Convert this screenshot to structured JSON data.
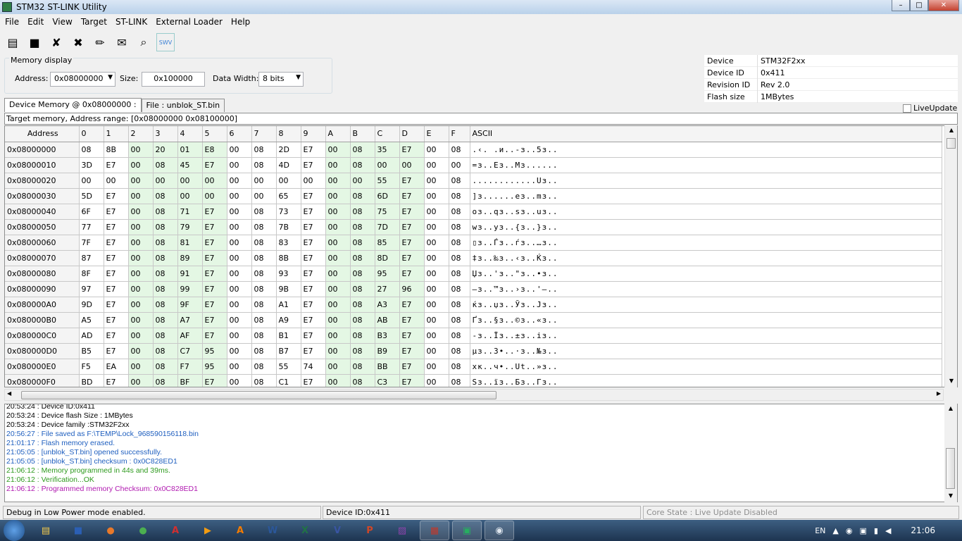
{
  "window": {
    "title": "STM32 ST-LINK Utility",
    "minimize": "–",
    "maximize": "□",
    "close": "✕"
  },
  "menu": [
    "File",
    "Edit",
    "View",
    "Target",
    "ST-LINK",
    "External Loader",
    "Help"
  ],
  "toolbar": [
    {
      "name": "open-file-icon",
      "glyph": "▤"
    },
    {
      "name": "save-file-icon",
      "glyph": "■"
    },
    {
      "name": "connect-icon",
      "glyph": "✘"
    },
    {
      "name": "disconnect-icon",
      "glyph": "✖"
    },
    {
      "name": "erase-icon",
      "glyph": "✏"
    },
    {
      "name": "program-icon",
      "glyph": "✉"
    },
    {
      "name": "search-icon",
      "glyph": "⌕"
    },
    {
      "name": "swv-icon",
      "glyph": "SWV"
    }
  ],
  "memory_display": {
    "legend": "Memory display",
    "address_label": "Address:",
    "address_value": "0x08000000",
    "size_label": "Size:",
    "size_value": "0x100000",
    "width_label": "Data Width:",
    "width_value": "8 bits"
  },
  "device_info": [
    {
      "key": "Device",
      "value": "STM32F2xx"
    },
    {
      "key": "Device ID",
      "value": "0x411"
    },
    {
      "key": "Revision ID",
      "value": "Rev 2.0"
    },
    {
      "key": "Flash size",
      "value": "1MBytes"
    }
  ],
  "live_update": "LiveUpdate",
  "tabs": [
    "Device Memory @ 0x08000000 :",
    "File : unblok_ST.bin"
  ],
  "range_text": "Target memory, Address range: [0x08000000 0x08100000]",
  "grid": {
    "headers": [
      "Address",
      "0",
      "1",
      "2",
      "3",
      "4",
      "5",
      "6",
      "7",
      "8",
      "9",
      "A",
      "B",
      "C",
      "D",
      "E",
      "F",
      "ASCII"
    ],
    "rows": [
      [
        "0x08000000",
        "08",
        "8B",
        "00",
        "20",
        "01",
        "E8",
        "00",
        "08",
        "2D",
        "E7",
        "00",
        "08",
        "35",
        "E7",
        "00",
        "08",
        ".‹. .и..-з..5з.."
      ],
      [
        "0x08000010",
        "3D",
        "E7",
        "00",
        "08",
        "45",
        "E7",
        "00",
        "08",
        "4D",
        "E7",
        "00",
        "08",
        "00",
        "00",
        "00",
        "00",
        "=з..Eз..Mз......"
      ],
      [
        "0x08000020",
        "00",
        "00",
        "00",
        "00",
        "00",
        "00",
        "00",
        "00",
        "00",
        "00",
        "00",
        "00",
        "55",
        "E7",
        "00",
        "08",
        "............Uз.."
      ],
      [
        "0x08000030",
        "5D",
        "E7",
        "00",
        "08",
        "00",
        "00",
        "00",
        "00",
        "65",
        "E7",
        "00",
        "08",
        "6D",
        "E7",
        "00",
        "08",
        "]з......eз..mз.."
      ],
      [
        "0x08000040",
        "6F",
        "E7",
        "00",
        "08",
        "71",
        "E7",
        "00",
        "08",
        "73",
        "E7",
        "00",
        "08",
        "75",
        "E7",
        "00",
        "08",
        "oз..qз..sз..uз.."
      ],
      [
        "0x08000050",
        "77",
        "E7",
        "00",
        "08",
        "79",
        "E7",
        "00",
        "08",
        "7B",
        "E7",
        "00",
        "08",
        "7D",
        "E7",
        "00",
        "08",
        "wз..yз..{з..}з.."
      ],
      [
        "0x08000060",
        "7F",
        "E7",
        "00",
        "08",
        "81",
        "E7",
        "00",
        "08",
        "83",
        "E7",
        "00",
        "08",
        "85",
        "E7",
        "00",
        "08",
        "▯з..Ѓз..ѓз..…з.."
      ],
      [
        "0x08000070",
        "87",
        "E7",
        "00",
        "08",
        "89",
        "E7",
        "00",
        "08",
        "8B",
        "E7",
        "00",
        "08",
        "8D",
        "E7",
        "00",
        "08",
        "‡з..‰з..‹з..Ќз.."
      ],
      [
        "0x08000080",
        "8F",
        "E7",
        "00",
        "08",
        "91",
        "E7",
        "00",
        "08",
        "93",
        "E7",
        "00",
        "08",
        "95",
        "E7",
        "00",
        "08",
        "Џз..'з..\"з..•з.."
      ],
      [
        "0x08000090",
        "97",
        "E7",
        "00",
        "08",
        "99",
        "E7",
        "00",
        "08",
        "9B",
        "E7",
        "00",
        "08",
        "27",
        "96",
        "00",
        "08",
        "—з..™з..›з..'–.."
      ],
      [
        "0x080000A0",
        "9D",
        "E7",
        "00",
        "08",
        "9F",
        "E7",
        "00",
        "08",
        "A1",
        "E7",
        "00",
        "08",
        "A3",
        "E7",
        "00",
        "08",
        "ќз..џз..Ўз..Јз.."
      ],
      [
        "0x080000B0",
        "A5",
        "E7",
        "00",
        "08",
        "A7",
        "E7",
        "00",
        "08",
        "A9",
        "E7",
        "00",
        "08",
        "AB",
        "E7",
        "00",
        "08",
        "Ґз..§з..©з..«з.."
      ],
      [
        "0x080000C0",
        "AD",
        "E7",
        "00",
        "08",
        "AF",
        "E7",
        "00",
        "08",
        "B1",
        "E7",
        "00",
        "08",
        "B3",
        "E7",
        "00",
        "08",
        "-з..Їз..±з..iз.."
      ],
      [
        "0x080000D0",
        "B5",
        "E7",
        "00",
        "08",
        "C7",
        "95",
        "00",
        "08",
        "B7",
        "E7",
        "00",
        "08",
        "B9",
        "E7",
        "00",
        "08",
        "µз..З•..·з..№з.."
      ],
      [
        "0x080000E0",
        "F5",
        "EA",
        "00",
        "08",
        "F7",
        "95",
        "00",
        "08",
        "55",
        "74",
        "00",
        "08",
        "BB",
        "E7",
        "00",
        "08",
        "хк..ч•..Ut..»з.."
      ],
      [
        "0x080000F0",
        "BD",
        "E7",
        "00",
        "08",
        "BF",
        "E7",
        "00",
        "08",
        "C1",
        "E7",
        "00",
        "08",
        "C3",
        "E7",
        "00",
        "08",
        "Sз..їз..Бз..Гз.."
      ]
    ]
  },
  "log": [
    {
      "text": "20:53:24 : Device ID:0x411",
      "color": "#000000"
    },
    {
      "text": "20:53:24 : Device flash Size : 1MBytes",
      "color": "#000000"
    },
    {
      "text": "20:53:24 : Device family :STM32F2xx",
      "color": "#000000"
    },
    {
      "text": "20:56:27 : File saved as F:\\TEMP\\Lock_968590156118.bin",
      "color": "#1f5fbf"
    },
    {
      "text": "21:01:17 : Flash memory erased.",
      "color": "#1f5fbf"
    },
    {
      "text": "21:05:05 : [unblok_ST.bin] opened successfully.",
      "color": "#1f5fbf"
    },
    {
      "text": "21:05:05 : [unblok_ST.bin] checksum : 0x0C828ED1",
      "color": "#1f5fbf"
    },
    {
      "text": "21:06:12 : Memory programmed in 44s and 39ms.",
      "color": "#2e9a1e"
    },
    {
      "text": "21:06:12 : Verification...OK",
      "color": "#2e9a1e"
    },
    {
      "text": "21:06:12 : Programmed memory Checksum: 0x0C828ED1",
      "color": "#b01ab0"
    }
  ],
  "status": {
    "left": "Debug in Low Power mode enabled.",
    "middle": "Device ID:0x411",
    "right": "Core State : Live Update Disabled"
  },
  "taskbar": {
    "apps": [
      {
        "name": "explorer-icon",
        "glyph": "▤",
        "color": "#f2c94c"
      },
      {
        "name": "save-app-icon",
        "glyph": "■",
        "color": "#2b5fb4"
      },
      {
        "name": "firefox-icon",
        "glyph": "●",
        "color": "#e8792a"
      },
      {
        "name": "chrome-icon",
        "glyph": "●",
        "color": "#4caf50"
      },
      {
        "name": "acrobat-icon",
        "glyph": "A",
        "color": "#d32f2f"
      },
      {
        "name": "media-player-icon",
        "glyph": "▶",
        "color": "#f39c12"
      },
      {
        "name": "avast-icon",
        "glyph": "A",
        "color": "#f57c00"
      },
      {
        "name": "word-icon",
        "glyph": "W",
        "color": "#2b579a"
      },
      {
        "name": "excel-icon",
        "glyph": "X",
        "color": "#217346"
      },
      {
        "name": "visio-icon",
        "glyph": "V",
        "color": "#3955a3"
      },
      {
        "name": "powerpoint-icon",
        "glyph": "P",
        "color": "#d24726"
      },
      {
        "name": "paint-icon",
        "glyph": "▨",
        "color": "#8e44ad"
      },
      {
        "name": "chart-app-icon",
        "glyph": "▦",
        "color": "#c0392b"
      },
      {
        "name": "stlink-task-icon",
        "glyph": "▣",
        "color": "#27ae60"
      },
      {
        "name": "network-app-icon",
        "glyph": "◉",
        "color": "#dfe6ee"
      }
    ],
    "lang": "EN",
    "clock": "21:06"
  }
}
